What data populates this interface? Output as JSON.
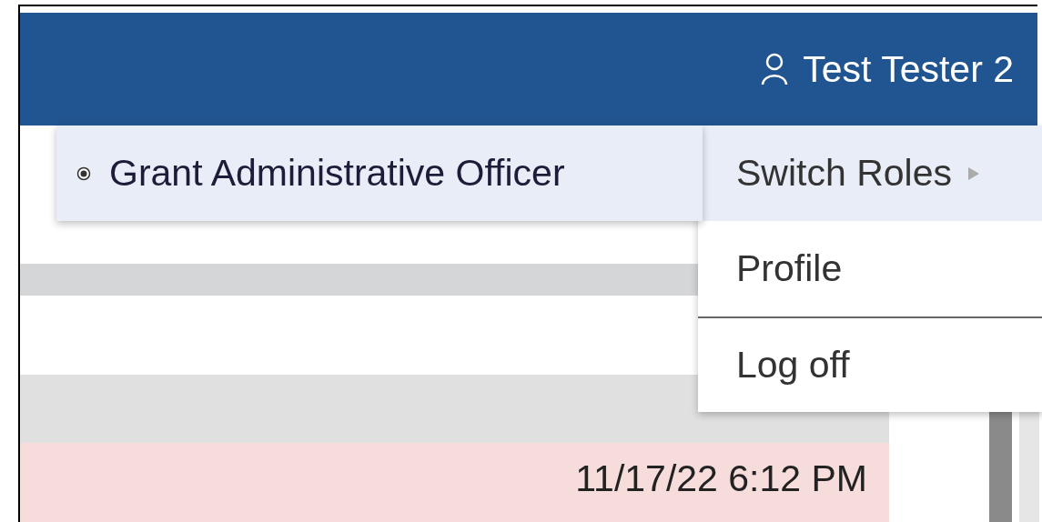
{
  "header": {
    "user_name": "Test Tester 2"
  },
  "user_menu": {
    "items": [
      {
        "label": "Switch Roles",
        "kind": "submenu",
        "selected": true
      },
      {
        "label": "Profile",
        "kind": "item",
        "selected": false
      },
      {
        "label": "Log off",
        "kind": "item",
        "selected": false
      }
    ]
  },
  "roles_menu": {
    "items": [
      {
        "label": "Grant Administrative Officer",
        "selected": true
      }
    ]
  },
  "table": {
    "rows": [
      {
        "date": "11/17/22 6:12 PM",
        "highlighted": true
      }
    ]
  }
}
